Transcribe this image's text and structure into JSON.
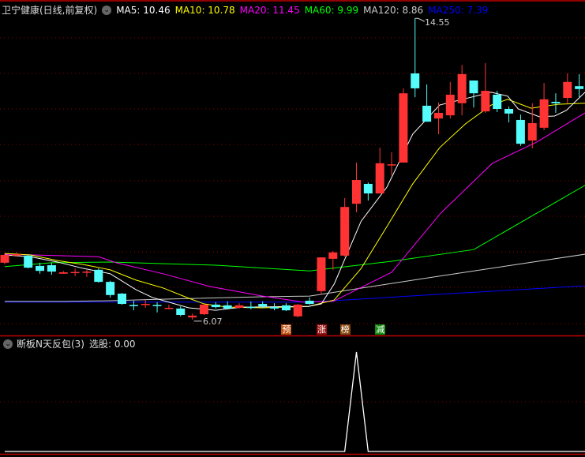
{
  "header": {
    "title": "卫宁健康(日线,前复权)",
    "ma": [
      {
        "label": "MA5: 10.46",
        "color": "#ffffff"
      },
      {
        "label": "MA10: 10.78",
        "color": "#ffff00"
      },
      {
        "label": "MA20: 11.45",
        "color": "#ff00ff"
      },
      {
        "label": "MA60: 9.99",
        "color": "#00ff00"
      },
      {
        "label": "MA120: 8.86",
        "color": "#cccccc"
      },
      {
        "label": "MA250: 7.39",
        "color": "#0000ff"
      }
    ]
  },
  "annotations": {
    "high_label": "14.55",
    "low_label": "6.07"
  },
  "markers": [
    {
      "text": "预",
      "index": 24,
      "color": "#c0500f"
    },
    {
      "text": "涨",
      "index": 27,
      "color": "#9a0f0f"
    },
    {
      "text": "榜",
      "index": 29,
      "color": "#8a4a10"
    },
    {
      "text": "减",
      "index": 32,
      "color": "#0f8a0f"
    }
  ],
  "indicator": {
    "title": "断板N天反包(3)",
    "value_label": "选股: 0.00",
    "values_nonzero": {
      "30": 1
    }
  },
  "colors": {
    "up": "#ff3333",
    "down": "#54fcfc",
    "grid": "#8b0000"
  },
  "chart_data": {
    "type": "candlestick",
    "ohlc": [
      [
        7.67,
        7.93,
        7.62,
        7.89
      ],
      [
        7.87,
        7.96,
        7.84,
        7.91
      ],
      [
        7.87,
        7.91,
        7.51,
        7.53
      ],
      [
        7.58,
        7.67,
        7.36,
        7.44
      ],
      [
        7.6,
        7.67,
        7.33,
        7.42
      ],
      [
        7.36,
        7.44,
        7.36,
        7.4
      ],
      [
        7.4,
        7.51,
        7.29,
        7.41
      ],
      [
        7.42,
        7.47,
        7.27,
        7.42
      ],
      [
        7.47,
        7.51,
        7.11,
        7.13
      ],
      [
        7.13,
        7.16,
        6.69,
        6.76
      ],
      [
        6.8,
        6.82,
        6.49,
        6.51
      ],
      [
        6.48,
        6.6,
        6.33,
        6.47
      ],
      [
        6.5,
        6.62,
        6.4,
        6.51
      ],
      [
        6.48,
        6.56,
        6.27,
        6.47
      ],
      [
        6.39,
        6.49,
        6.36,
        6.4
      ],
      [
        6.38,
        6.44,
        6.16,
        6.2
      ],
      [
        6.13,
        6.24,
        6.07,
        6.18
      ],
      [
        6.22,
        6.51,
        6.2,
        6.49
      ],
      [
        6.49,
        6.56,
        6.38,
        6.42
      ],
      [
        6.47,
        6.58,
        6.36,
        6.38
      ],
      [
        6.4,
        6.53,
        6.38,
        6.47
      ],
      [
        6.43,
        6.58,
        6.36,
        6.42
      ],
      [
        6.51,
        6.58,
        6.4,
        6.44
      ],
      [
        6.42,
        6.53,
        6.33,
        6.38
      ],
      [
        6.47,
        6.53,
        6.31,
        6.33
      ],
      [
        6.16,
        6.51,
        6.13,
        6.49
      ],
      [
        6.6,
        6.69,
        6.49,
        6.51
      ],
      [
        6.87,
        7.82,
        6.78,
        7.82
      ],
      [
        7.78,
        8.0,
        7.47,
        7.96
      ],
      [
        7.87,
        9.49,
        7.84,
        9.24
      ],
      [
        9.33,
        10.49,
        9.09,
        10.0
      ],
      [
        9.89,
        9.93,
        9.42,
        9.62
      ],
      [
        9.62,
        10.91,
        9.62,
        10.47
      ],
      [
        10.42,
        10.78,
        10.13,
        10.44
      ],
      [
        10.49,
        12.58,
        10.49,
        12.44
      ],
      [
        13.0,
        14.55,
        12.33,
        12.58
      ],
      [
        12.09,
        12.69,
        11.64,
        11.64
      ],
      [
        11.73,
        12.18,
        11.29,
        11.89
      ],
      [
        11.82,
        12.76,
        11.73,
        12.4
      ],
      [
        12.16,
        13.24,
        11.82,
        12.98
      ],
      [
        12.8,
        12.8,
        12.04,
        12.44
      ],
      [
        11.93,
        13.29,
        11.89,
        12.51
      ],
      [
        12.4,
        12.51,
        11.91,
        12.0
      ],
      [
        12.0,
        12.07,
        11.62,
        11.87
      ],
      [
        11.69,
        11.84,
        10.96,
        11.02
      ],
      [
        11.11,
        12.16,
        10.89,
        11.6
      ],
      [
        11.47,
        12.73,
        11.4,
        12.27
      ],
      [
        12.2,
        12.44,
        11.89,
        12.16
      ],
      [
        12.31,
        13.0,
        12.16,
        12.76
      ],
      [
        12.64,
        12.98,
        12.33,
        12.56
      ]
    ],
    "ma_series": [
      {
        "name": "MA5",
        "color": "#ffffff",
        "points": [
          [
            0,
            7.89
          ],
          [
            2.2,
            7.84
          ],
          [
            4.5,
            7.69
          ],
          [
            6.7,
            7.51
          ],
          [
            9,
            7.36
          ],
          [
            11.2,
            6.91
          ],
          [
            12.6,
            6.69
          ],
          [
            15.7,
            6.4
          ],
          [
            18,
            6.33
          ],
          [
            20.2,
            6.42
          ],
          [
            25.9,
            6.44
          ],
          [
            27,
            6.51
          ],
          [
            28.1,
            7.07
          ],
          [
            30.4,
            8.84
          ],
          [
            32.6,
            9.8
          ],
          [
            34.8,
            11.29
          ],
          [
            37.1,
            12.11
          ],
          [
            39.3,
            12.29
          ],
          [
            41.5,
            12.47
          ],
          [
            42.9,
            12.36
          ],
          [
            43.8,
            12.0
          ],
          [
            45.6,
            11.78
          ],
          [
            46.9,
            11.8
          ],
          [
            47.9,
            11.96
          ],
          [
            49.5,
            12.47
          ]
        ]
      },
      {
        "name": "MA10",
        "color": "#ffff00",
        "points": [
          [
            0,
            7.93
          ],
          [
            2.2,
            7.89
          ],
          [
            4.5,
            7.73
          ],
          [
            6.7,
            7.62
          ],
          [
            9,
            7.47
          ],
          [
            11.2,
            7.18
          ],
          [
            13.5,
            6.96
          ],
          [
            15.7,
            6.67
          ],
          [
            17,
            6.51
          ],
          [
            19,
            6.42
          ],
          [
            22,
            6.4
          ],
          [
            25.9,
            6.44
          ],
          [
            28.1,
            6.62
          ],
          [
            30.4,
            7.51
          ],
          [
            32.6,
            8.69
          ],
          [
            34.8,
            9.89
          ],
          [
            37.1,
            10.91
          ],
          [
            39.3,
            11.58
          ],
          [
            41.5,
            12.11
          ],
          [
            42.9,
            12.27
          ],
          [
            44.9,
            12.02
          ],
          [
            47.2,
            12.13
          ],
          [
            49.5,
            12.16
          ]
        ]
      },
      {
        "name": "MA20",
        "color": "#ff00ff",
        "points": [
          [
            0,
            7.91
          ],
          [
            8,
            7.84
          ],
          [
            9.5,
            7.67
          ],
          [
            13.5,
            7.36
          ],
          [
            17.5,
            7.0
          ],
          [
            22,
            6.73
          ],
          [
            25.5,
            6.56
          ],
          [
            28,
            6.58
          ],
          [
            33,
            7.4
          ],
          [
            37.2,
            9.07
          ],
          [
            41.6,
            10.47
          ],
          [
            45.4,
            11.07
          ],
          [
            49.5,
            11.89
          ]
        ]
      },
      {
        "name": "MA60",
        "color": "#00ff00",
        "points": [
          [
            0,
            7.56
          ],
          [
            4,
            7.67
          ],
          [
            9,
            7.69
          ],
          [
            18,
            7.6
          ],
          [
            26,
            7.44
          ],
          [
            33,
            7.71
          ],
          [
            40,
            8.04
          ],
          [
            49.5,
            9.85
          ]
        ]
      },
      {
        "name": "MA120",
        "color": "#cccccc",
        "points": [
          [
            0,
            6.58
          ],
          [
            5,
            6.58
          ],
          [
            9,
            6.6
          ],
          [
            13,
            6.64
          ],
          [
            22,
            6.71
          ],
          [
            26,
            6.73
          ],
          [
            37,
            7.29
          ],
          [
            49.5,
            7.91
          ]
        ]
      },
      {
        "name": "MA250",
        "color": "#0000ff",
        "points": [
          [
            0,
            6.56
          ],
          [
            26,
            6.56
          ],
          [
            37,
            6.78
          ],
          [
            49.5,
            7.02
          ]
        ]
      }
    ],
    "high": {
      "index": 35,
      "value": 14.55
    },
    "low": {
      "index": 16,
      "value": 6.07
    }
  }
}
